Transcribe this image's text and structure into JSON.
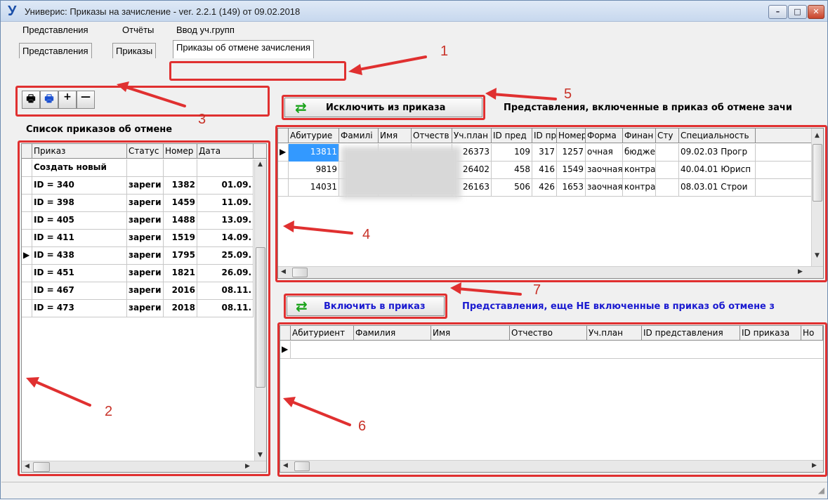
{
  "window": {
    "title": "Универис: Приказы на зачисление  -  ver. 2.2.1 (149) от 09.02.2018",
    "app_icon": "У",
    "controls": [
      "minimize-icon",
      "maximize-icon",
      "close-icon"
    ]
  },
  "menu": [
    "Представления",
    "Отчёты",
    "Ввод уч.групп"
  ],
  "tabs": [
    "Представления",
    "Приказы",
    "Приказы об отмене зачисления"
  ],
  "toolbar": {
    "buttons": [
      "printer-icon",
      "print-color-icon",
      "plus-icon",
      "minus-icon"
    ]
  },
  "left_panel": {
    "heading": "Список приказов об отмене",
    "columns": [
      "Приказ",
      "Статус",
      "Номер",
      "Дата"
    ],
    "rows": [
      [
        "Создать новый",
        "",
        "",
        ""
      ],
      [
        "ID = 340",
        "зареги",
        "1382",
        "01.09."
      ],
      [
        "ID = 398",
        "зареги",
        "1459",
        "11.09."
      ],
      [
        "ID = 405",
        "зареги",
        "1488",
        "13.09."
      ],
      [
        "ID = 411",
        "зареги",
        "1519",
        "14.09."
      ],
      [
        "ID = 438",
        "зареги",
        "1795",
        "25.09."
      ],
      [
        "ID = 451",
        "зареги",
        "1821",
        "26.09."
      ],
      [
        "ID = 467",
        "зареги",
        "2016",
        "08.11."
      ],
      [
        "ID = 473",
        "зареги",
        "2018",
        "08.11."
      ]
    ],
    "current_row": 5
  },
  "top_right": {
    "button_label": "Исключить из  приказа",
    "caption": "Представления, включенные в приказ об отмене зачи",
    "columns": [
      "Абитурие",
      "Фамилі",
      "Имя",
      "Отчеств",
      "Уч.план",
      "ID пред",
      "ID пр",
      "Номер",
      "Форма",
      "Финан",
      "Сту",
      "Специальность"
    ],
    "rows": [
      [
        "13811",
        "",
        "",
        "",
        "26373",
        "109",
        "317",
        "1257",
        "очная",
        "бюджет",
        "",
        "09.02.03 Прогр"
      ],
      [
        "9819",
        "",
        "",
        "",
        "26402",
        "458",
        "416",
        "1549",
        "заочная",
        "контра",
        "",
        "40.04.01 Юрисп"
      ],
      [
        "14031",
        "",
        "",
        "",
        "26163",
        "506",
        "426",
        "1653",
        "заочная",
        "контра",
        "",
        "08.03.01 Строи"
      ]
    ]
  },
  "bottom_right": {
    "button_label": "Включить в приказ",
    "caption": "Представления, еще НЕ включенные в приказ об отмене з",
    "columns": [
      "Абитуриент",
      "Фамилия",
      "Имя",
      "Отчество",
      "Уч.план",
      "ID представления",
      "ID приказа",
      "Но"
    ]
  },
  "annotations": [
    "1",
    "2",
    "3",
    "4",
    "5",
    "6",
    "7"
  ],
  "colors": {
    "annotation_red": "#e03030",
    "selection": "#3399ff",
    "caption_blue": "#1a1ad0",
    "arrow_green": "#1aa31a"
  }
}
